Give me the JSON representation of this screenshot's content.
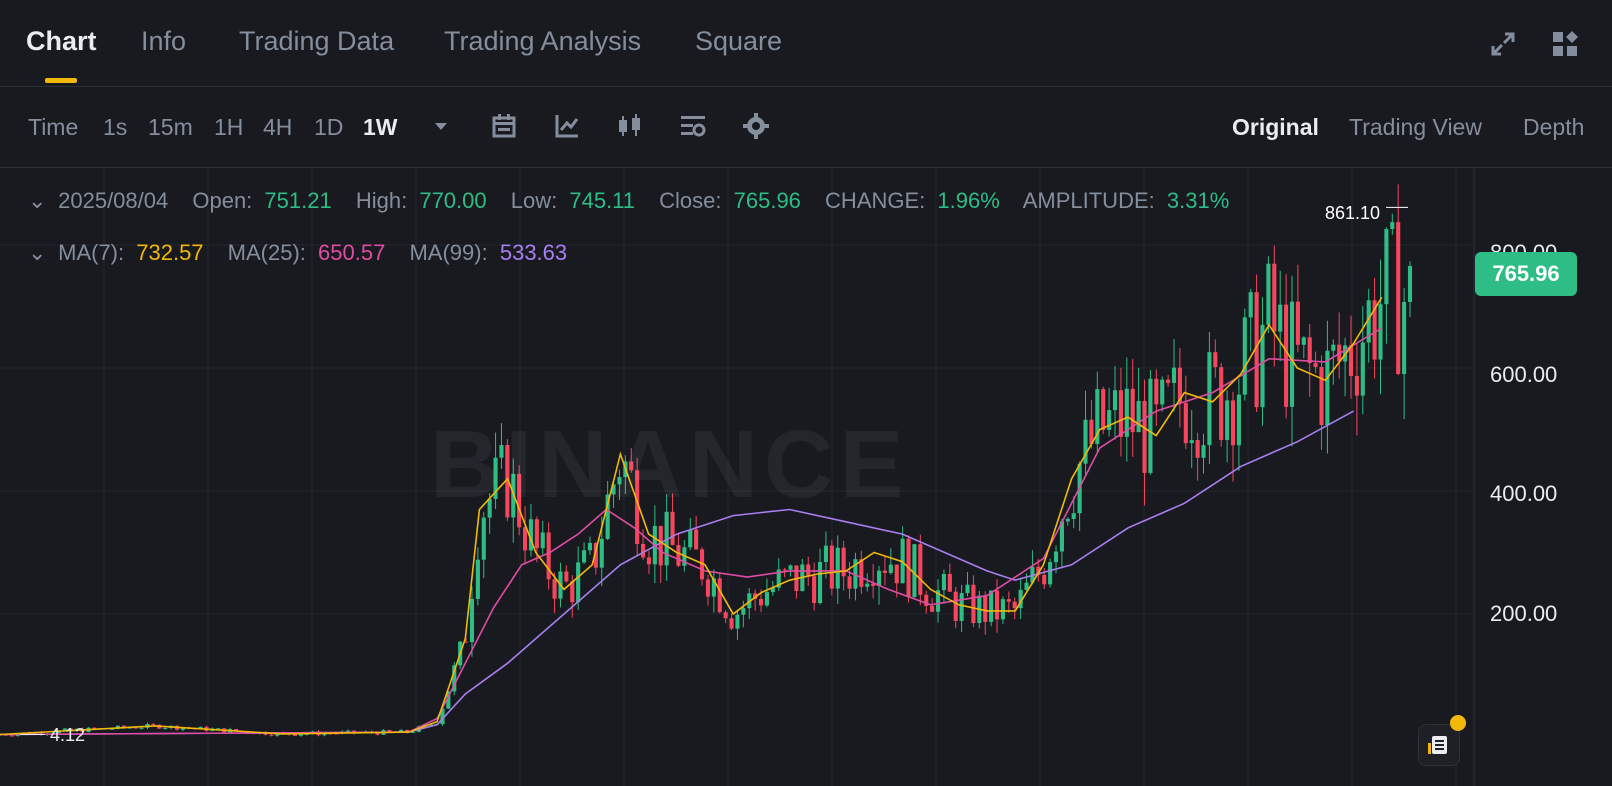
{
  "tabs": {
    "chart": "Chart",
    "info": "Info",
    "trading_data": "Trading Data",
    "trading_analysis": "Trading Analysis",
    "square": "Square"
  },
  "header_icons": [
    "expand-icon",
    "layout-grid-icon"
  ],
  "toolbar": {
    "time": "Time",
    "tf_1s": "1s",
    "tf_15m": "15m",
    "tf_1h": "1H",
    "tf_4h": "4H",
    "tf_1d": "1D",
    "tf_1w": "1W",
    "icons": [
      "dropdown-caret-icon",
      "calendar-icon",
      "indicator-icon",
      "candlestick-icon",
      "chart-settings-icon",
      "gear-icon"
    ],
    "view_original": "Original",
    "view_trading_view": "Trading View",
    "view_depth": "Depth"
  },
  "ohlc": {
    "date": "2025/08/04",
    "open_label": "Open:",
    "open": "751.21",
    "high_label": "High:",
    "high": "770.00",
    "low_label": "Low:",
    "low": "745.11",
    "close_label": "Close:",
    "close": "765.96",
    "change_label": "CHANGE:",
    "change": "1.96%",
    "amplitude_label": "AMPLITUDE:",
    "amplitude": "3.31%"
  },
  "ma": {
    "ma7_label": "MA(7):",
    "ma7": "732.57",
    "ma25_label": "MA(25):",
    "ma25": "650.57",
    "ma99_label": "MA(99):",
    "ma99": "533.63"
  },
  "watermark": "BINANCE",
  "colors": {
    "up": "#2ebd85",
    "down": "#f6465d",
    "ma7": "#f0b90b",
    "ma25": "#e04ca3",
    "ma99": "#a77ff0",
    "accent": "#f0b90b"
  },
  "chart_data": {
    "type": "candlestick",
    "y_ticks": [
      "200.00",
      "400.00",
      "600.00",
      "800.00"
    ],
    "ylim": [
      0,
      900
    ],
    "current_price": "765.96",
    "high_marker": "861.10",
    "low_marker": "4.12",
    "ma7_series_key": [
      [
        0,
        4
      ],
      [
        0.11,
        18
      ],
      [
        0.2,
        5
      ],
      [
        0.29,
        8
      ],
      [
        0.31,
        25
      ],
      [
        0.33,
        160
      ],
      [
        0.34,
        370
      ],
      [
        0.36,
        420
      ],
      [
        0.37,
        360
      ],
      [
        0.38,
        300
      ],
      [
        0.4,
        240
      ],
      [
        0.42,
        280
      ],
      [
        0.44,
        460
      ],
      [
        0.46,
        330
      ],
      [
        0.48,
        300
      ],
      [
        0.5,
        280
      ],
      [
        0.52,
        200
      ],
      [
        0.54,
        235
      ],
      [
        0.56,
        255
      ],
      [
        0.58,
        265
      ],
      [
        0.6,
        270
      ],
      [
        0.62,
        300
      ],
      [
        0.64,
        285
      ],
      [
        0.66,
        240
      ],
      [
        0.68,
        215
      ],
      [
        0.7,
        205
      ],
      [
        0.72,
        205
      ],
      [
        0.74,
        280
      ],
      [
        0.76,
        420
      ],
      [
        0.78,
        500
      ],
      [
        0.8,
        520
      ],
      [
        0.82,
        490
      ],
      [
        0.84,
        560
      ],
      [
        0.86,
        545
      ],
      [
        0.88,
        590
      ],
      [
        0.9,
        670
      ],
      [
        0.92,
        600
      ],
      [
        0.94,
        580
      ],
      [
        0.96,
        640
      ],
      [
        0.98,
        715
      ]
    ],
    "ma25_series_key": [
      [
        0,
        4
      ],
      [
        0.29,
        8
      ],
      [
        0.31,
        30
      ],
      [
        0.33,
        120
      ],
      [
        0.35,
        210
      ],
      [
        0.37,
        280
      ],
      [
        0.39,
        300
      ],
      [
        0.41,
        330
      ],
      [
        0.43,
        370
      ],
      [
        0.45,
        340
      ],
      [
        0.47,
        300
      ],
      [
        0.5,
        270
      ],
      [
        0.53,
        260
      ],
      [
        0.56,
        270
      ],
      [
        0.6,
        270
      ],
      [
        0.63,
        240
      ],
      [
        0.66,
        215
      ],
      [
        0.7,
        230
      ],
      [
        0.74,
        290
      ],
      [
        0.76,
        380
      ],
      [
        0.78,
        470
      ],
      [
        0.82,
        530
      ],
      [
        0.86,
        560
      ],
      [
        0.9,
        615
      ],
      [
        0.94,
        610
      ],
      [
        0.98,
        665
      ]
    ],
    "ma99_series_key": [
      [
        0,
        4
      ],
      [
        0.29,
        8
      ],
      [
        0.31,
        20
      ],
      [
        0.33,
        70
      ],
      [
        0.36,
        120
      ],
      [
        0.4,
        200
      ],
      [
        0.44,
        280
      ],
      [
        0.48,
        330
      ],
      [
        0.52,
        360
      ],
      [
        0.56,
        370
      ],
      [
        0.6,
        350
      ],
      [
        0.64,
        330
      ],
      [
        0.68,
        290
      ],
      [
        0.7,
        270
      ],
      [
        0.72,
        255
      ],
      [
        0.76,
        280
      ],
      [
        0.8,
        340
      ],
      [
        0.84,
        380
      ],
      [
        0.88,
        440
      ],
      [
        0.92,
        480
      ],
      [
        0.96,
        530
      ]
    ]
  }
}
